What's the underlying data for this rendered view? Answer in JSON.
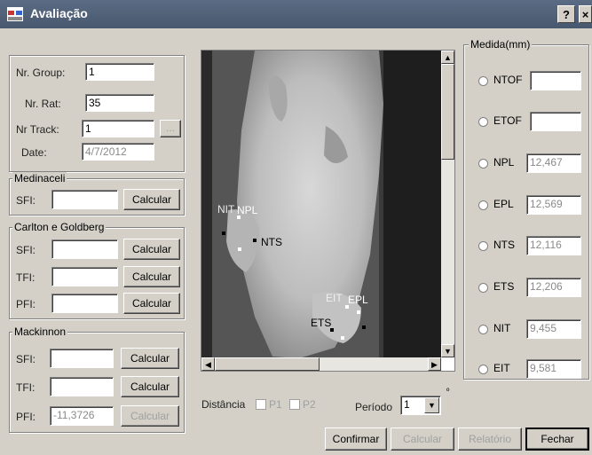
{
  "window": {
    "title": "Avaliação",
    "help": "?",
    "close": "×"
  },
  "info": {
    "group_label": "Nr. Group:",
    "group_value": "1",
    "rat_label": "Nr. Rat:",
    "rat_value": "35",
    "track_label": "Nr Track:",
    "track_value": "1",
    "track_btn": "...",
    "date_label": "Date:",
    "date_value": "4/7/2012"
  },
  "medinaceli": {
    "title": "Medinaceli",
    "sfi_label": "SFI:",
    "sfi_value": "",
    "calc": "Calcular"
  },
  "carlton": {
    "title": "Carlton e Goldberg",
    "sfi_label": "SFI:",
    "sfi_value": "",
    "tfi_label": "TFI:",
    "tfi_value": "",
    "pfi_label": "PFI:",
    "pfi_value": "",
    "calc1": "Calcular",
    "calc2": "Calcular",
    "calc3": "Calcular"
  },
  "mackinnon": {
    "title": "Mackinnon",
    "sfi_label": "SFI:",
    "sfi_value": "",
    "tfi_label": "TFI:",
    "tfi_value": "",
    "pfi_label": "PFI:",
    "pfi_value": "-11,3726",
    "calc1": "Calcular",
    "calc2": "Calcular",
    "calc3": "Calcular"
  },
  "image_labels": {
    "nit": "NIT",
    "npl": "NPL",
    "nts": "NTS",
    "eit": "EIT",
    "epl": "EPL",
    "ets": "ETS"
  },
  "controls": {
    "distancia": "Distância",
    "p1": "P1",
    "p2": "P2",
    "periodo": "Período",
    "periodo_value": "1",
    "periodo_suffix": "º"
  },
  "medida": {
    "title": "Medida(mm)",
    "items": [
      {
        "label": "NTOF",
        "value": ""
      },
      {
        "label": "ETOF",
        "value": ""
      },
      {
        "label": "NPL",
        "value": "12,467"
      },
      {
        "label": "EPL",
        "value": "12,569"
      },
      {
        "label": "NTS",
        "value": "12,116"
      },
      {
        "label": "ETS",
        "value": "12,206"
      },
      {
        "label": "NIT",
        "value": "9,455"
      },
      {
        "label": "EIT",
        "value": "9,581"
      }
    ]
  },
  "buttons": {
    "confirmar": "Confirmar",
    "calcular": "Calcular",
    "relatorio": "Relatório",
    "fechar": "Fechar"
  }
}
